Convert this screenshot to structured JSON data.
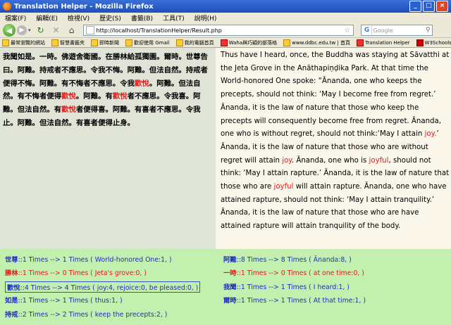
{
  "window": {
    "title": "Translation Helper - Mozilla Firefox",
    "min": "_",
    "max": "□",
    "close": "×"
  },
  "menu": [
    "檔案(F)",
    "編輯(E)",
    "檢視(V)",
    "歷史(S)",
    "書籤(B)",
    "工具(T)",
    "說明(H)"
  ],
  "nav": {
    "back": "◀",
    "forward": "▶",
    "dropdown": "▾",
    "reload": "↻",
    "stop": "✕",
    "home": "⌂",
    "url": "http://localhost/TranslationHelper/Result.php",
    "search_placeholder": "Google",
    "search_engine": "G"
  },
  "bookmarks": [
    "最常瀏覽的網站",
    "智慧書籤夾",
    "即時新聞",
    "歡迎使用 Gmail",
    "我的電腦首頁",
    "Waha與巧穎的部落格",
    "www.ddbc.edu.tw | 首頁",
    "Translation Helper",
    "W3Schools"
  ],
  "source": [
    {
      "t": "我聞如是。一時。佛遊舍衛國。在勝林給孤獨園。爾時。世尊告曰。"
    },
    {
      "t": "阿難。持戒者不應思。令我不悔。阿難。但法自然。持戒者便得不"
    },
    {
      "t": "悔。阿難。有不悔者不應思。令我"
    },
    {
      "t": "歡悅",
      "red": true
    },
    {
      "t": "。阿難。但法自然。有不悔者便得"
    },
    {
      "t": "歡悅",
      "red": true
    },
    {
      "t": "。阿難。有"
    },
    {
      "t": "歡悅",
      "red": true
    },
    {
      "t": "者不應思。令我喜。阿難。但法自然。有"
    },
    {
      "t": "歡悅",
      "red": true
    },
    {
      "t": "者便得喜。阿難。有喜者不應思。令我止。阿難。但法自然。有喜者便得止身。"
    }
  ],
  "translation": [
    {
      "t": "Thus have I heard, once, the Buddha was staying at Sāvatthi at the Jeta Grove in the Anāthapiṇḍika Park. At that time the World-honored One spoke: “Ānanda, one who keeps the precepts, should not think: ‘May I become free from regret.’ Ānanda, it is the law of nature that those who keep the precepts will consequently become free from regret. Ānanda, one who is without regret, should not think:‘May I attain "
    },
    {
      "t": "joy.",
      "red": true
    },
    {
      "t": "’ Ānanda, it is the law of nature that those who are without regret will attain "
    },
    {
      "t": "joy",
      "red": true
    },
    {
      "t": ". Ānanda, one who is "
    },
    {
      "t": "joyful",
      "red": true
    },
    {
      "t": ", should not think: ‘May I attain rapture.’ Ānanda, it is the law of nature that those who are "
    },
    {
      "t": "joyful",
      "red": true
    },
    {
      "t": " will attain rapture. Ānanda, one who have attained rapture, should not think: ‘May I attain tranquility.’ Ānanda, it is the law of nature that those who are have attained rapture will attain tranquility of the body."
    }
  ],
  "stats_left": [
    {
      "key": "世尊",
      "text": "::1 Times --> 1 Times ( World-honored One:1, )",
      "style": "blue"
    },
    {
      "key": "勝林",
      "text": "::1 Times --> 0 Times ( Jeta's grove:0, )",
      "style": "red"
    },
    {
      "key": "歡悅",
      "text": "::4 Times --> 4 Times ( joy:4, rejoice:0, be pleased:0, )",
      "style": "boxed"
    },
    {
      "key": "如是",
      "text": "::1 Times --> 1 Times ( thus:1, )",
      "style": "blue"
    },
    {
      "key": "持戒",
      "text": "::2 Times --> 2 Times ( keep the precepts:2, )",
      "style": "blue"
    }
  ],
  "stats_right": [
    {
      "key": "阿難",
      "text": "::8 Times --> 8 Times ( Ānanda:8, )",
      "style": "blue"
    },
    {
      "key": "一時",
      "text": "::1 Times --> 0 Times ( at one time:0, )",
      "style": "red"
    },
    {
      "key": "我聞",
      "text": "::1 Times --> 1 Times ( I heard:1, )",
      "style": "blue"
    },
    {
      "key": "爾時",
      "text": "::1 Times --> 1 Times ( At that time:1, )",
      "style": "blue"
    }
  ]
}
